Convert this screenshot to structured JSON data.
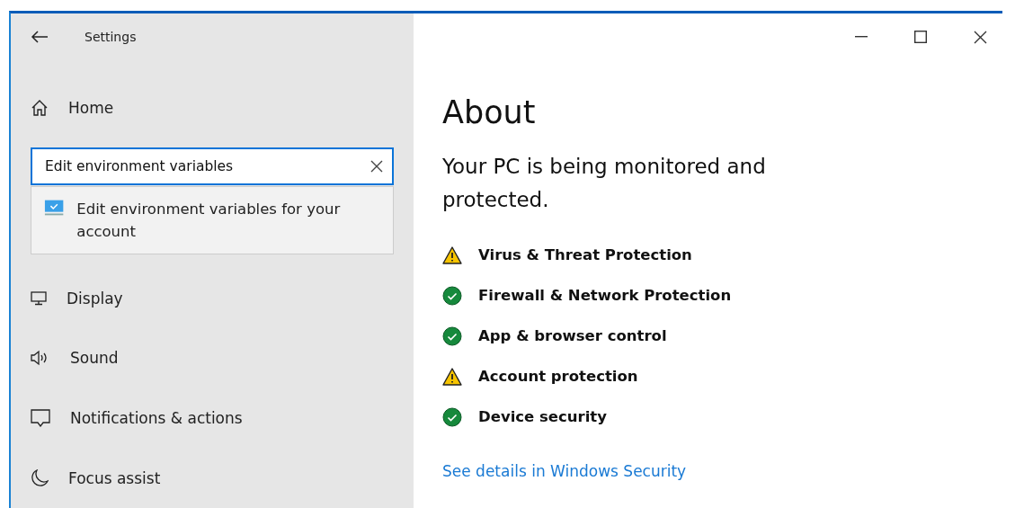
{
  "window": {
    "title": "Settings"
  },
  "sidebar": {
    "home": "Home",
    "search": {
      "value": "Edit environment variables"
    },
    "suggestions": [
      {
        "label": "Edit environment variables for your account"
      }
    ],
    "items": [
      {
        "label": "Display",
        "kind": "display"
      },
      {
        "label": "Sound",
        "kind": "sound"
      },
      {
        "label": "Notifications & actions",
        "kind": "notifications"
      },
      {
        "label": "Focus assist",
        "kind": "focus"
      }
    ]
  },
  "content": {
    "title": "About",
    "subtitle": "Your PC is being monitored and protected.",
    "statuses": [
      {
        "label": "Virus & Threat Protection",
        "kind": "warning"
      },
      {
        "label": "Firewall & Network Protection",
        "kind": "ok"
      },
      {
        "label": "App & browser control",
        "kind": "ok"
      },
      {
        "label": "Account protection",
        "kind": "warning"
      },
      {
        "label": "Device security",
        "kind": "ok"
      }
    ],
    "link": "See details in Windows Security"
  }
}
